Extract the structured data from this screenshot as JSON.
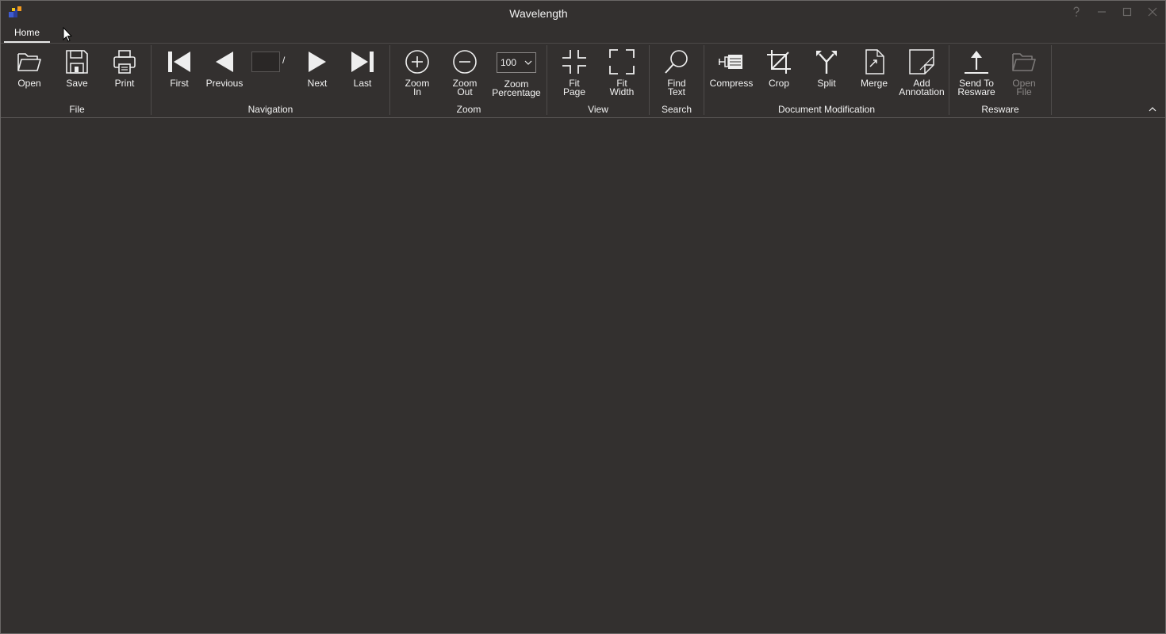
{
  "window": {
    "title": "Wavelength"
  },
  "tabs": [
    {
      "label": "Home"
    }
  ],
  "groups": {
    "file": "File",
    "navigation": "Navigation",
    "zoom": "Zoom",
    "view": "View",
    "search": "Search",
    "document_modification": "Document Modification",
    "resware": "Resware"
  },
  "buttons": {
    "open": "Open",
    "save": "Save",
    "print": "Print",
    "first": "First",
    "previous": "Previous",
    "next": "Next",
    "last": "Last",
    "zoom_in": "Zoom\nIn",
    "zoom_out": "Zoom\nOut",
    "zoom_percentage": "Zoom\nPercentage",
    "fit_page": "Fit\nPage",
    "fit_width": "Fit\nWidth",
    "find_text": "Find\nText",
    "compress": "Compress",
    "crop": "Crop",
    "split": "Split",
    "merge": "Merge",
    "add_annotation": "Add\nAnnotation",
    "send_to_resware": "Send To\nResware",
    "open_file": "Open\nFile"
  },
  "navigation": {
    "page_value": "",
    "separator": "/"
  },
  "zoom": {
    "value": "100"
  },
  "icons": {
    "help": "help-icon",
    "minimize": "minimize-icon",
    "maximize": "maximize-icon",
    "close": "close-icon"
  },
  "colors": {
    "background": "#33302f",
    "text": "#f2f2f2",
    "disabled": "#8a8786"
  }
}
